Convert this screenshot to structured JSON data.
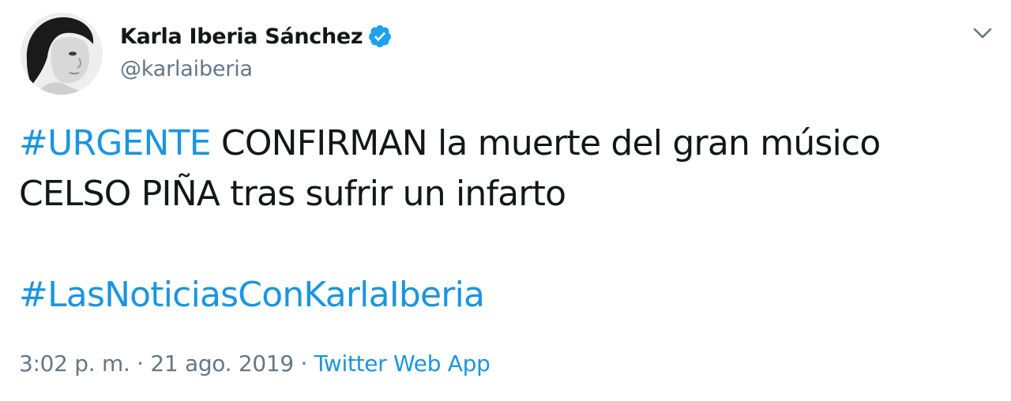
{
  "author": {
    "display_name": "Karla Iberia Sánchez",
    "handle": "@karlaiberia",
    "verified": true,
    "verified_color": "#1da1f2"
  },
  "tweet": {
    "hashtag_urgent": "#URGENTE",
    "line1_rest": " CONFIRMAN la muerte del gran músico",
    "line2": "CELSO PIÑA tras sufrir un infarto",
    "hashtag_show": "#LasNoticiasConKarlaIberia"
  },
  "meta": {
    "timestamp": "3:02 p. m. · 21 ago. 2019",
    "separator": " · ",
    "source": "Twitter Web App"
  },
  "colors": {
    "link": "#1b95e0",
    "text": "#14171a",
    "muted": "#657786"
  },
  "icons": {
    "avatar": "avatar-photo",
    "verified": "verified-badge-icon",
    "menu": "chevron-down-icon"
  }
}
